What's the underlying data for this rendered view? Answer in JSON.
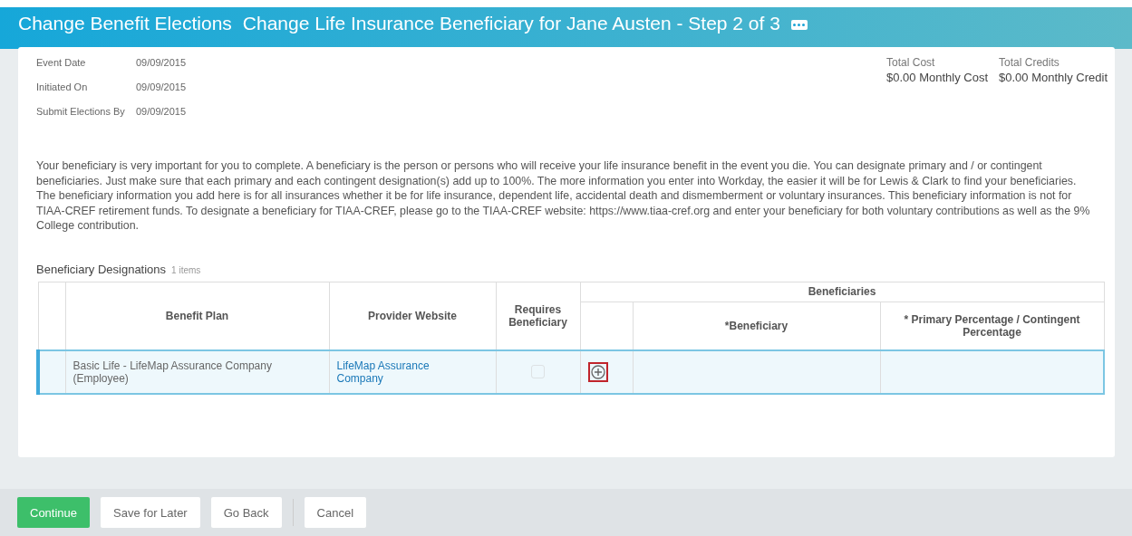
{
  "header": {
    "title": "Change Benefit Elections",
    "subtitle": "Change Life Insurance Beneficiary for Jane Austen - Step 2 of 3"
  },
  "details": [
    {
      "label": "Event Date",
      "value": "09/09/2015"
    },
    {
      "label": "Initiated On",
      "value": "09/09/2015"
    },
    {
      "label": "Submit Elections By",
      "value": "09/09/2015"
    }
  ],
  "totals": [
    {
      "label": "Total Cost",
      "value": "$0.00 Monthly Cost"
    },
    {
      "label": "Total Credits",
      "value": "$0.00 Monthly Credit"
    }
  ],
  "instructions": "Your beneficiary is very important for you to complete. A beneficiary is the person or persons who will receive your life insurance benefit in the event you die. You can designate primary and / or contingent beneficiaries. Just make sure that each primary and each contingent designation(s) add up to 100%. The more information you enter into Workday, the easier it will be for Lewis & Clark to find your beneficiaries. The beneficiary information you add here is for all  insurances whether it be for life insurance, dependent life, accidental death and dismemberment or voluntary insurances. This beneficiary information is not for TIAA-CREF retirement funds. To designate a beneficiary for TIAA-CREF, please go to the TIAA-CREF website: https://www.tiaa-cref.org and enter your beneficiary for both voluntary contributions as well as the 9% College contribution.",
  "table": {
    "title": "Beneficiary Designations",
    "count": "1 items",
    "group_header": "Beneficiaries",
    "columns": [
      "Benefit Plan",
      "Provider Website",
      "Requires Beneficiary",
      "*Beneficiary",
      "*  Primary Percentage / Contingent Percentage"
    ],
    "rows": [
      {
        "benefit_plan": "Basic Life - LifeMap Assurance Company (Employee)",
        "provider_website": "LifeMap Assurance Company",
        "requires_beneficiary": {
          "checked": false,
          "disabled": true
        },
        "selected": true
      }
    ]
  },
  "buttons": [
    {
      "label": "Continue",
      "kind": "primary"
    },
    {
      "label": "Save for Later",
      "kind": "secondary"
    },
    {
      "label": "Go Back",
      "kind": "secondary"
    },
    {
      "label": "Cancel",
      "kind": "secondary"
    }
  ]
}
